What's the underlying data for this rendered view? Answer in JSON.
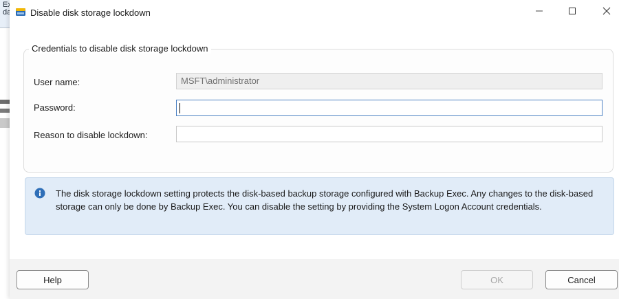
{
  "background": {
    "partial_text": "Exec. This setting is\nda"
  },
  "dialog": {
    "title": "Disable disk storage lockdown",
    "window_controls": {
      "minimize_icon": "minimize-icon",
      "maximize_icon": "maximize-icon",
      "close_icon": "close-icon"
    }
  },
  "credentials": {
    "group_label": "Credentials to disable disk storage lockdown",
    "user_name_label": "User name:",
    "user_name_value": "MSFT\\administrator",
    "password_label": "Password:",
    "password_value": "",
    "reason_label": "Reason to disable lockdown:",
    "reason_value": ""
  },
  "info": {
    "icon": "info-icon",
    "text": "The disk storage lockdown setting protects the disk-based backup storage configured with Backup Exec. Any changes to the disk-based storage can only be done by Backup Exec. You can disable the setting by providing the System Logon Account credentials."
  },
  "buttons": {
    "help": "Help",
    "ok": "OK",
    "cancel": "Cancel"
  },
  "colors": {
    "info_background": "#e1ecf8",
    "info_icon": "#2f6fb8",
    "focus_border": "#4a7fc1"
  }
}
